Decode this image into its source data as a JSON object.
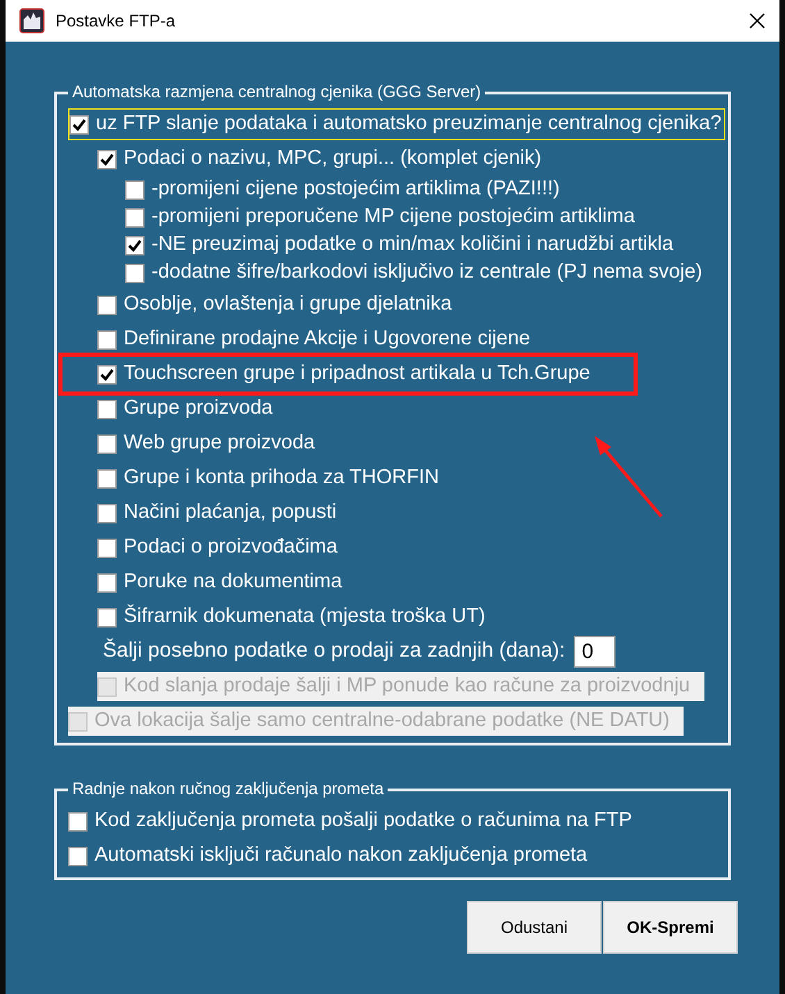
{
  "window": {
    "title": "Postavke FTP-a"
  },
  "group_1": {
    "legend": "Automatska razmjena centralnog cjenika (GGG Server)",
    "items": [
      {
        "kind": "checkbox",
        "label": "uz FTP slanje podataka i automatsko preuzimanje centralnog cjenika?",
        "checked": true,
        "disabled": false,
        "focused": true,
        "children": [
          {
            "kind": "checkbox",
            "label": "Podaci o nazivu, MPC, grupi... (komplet cjenik)",
            "checked": true,
            "disabled": false,
            "children": [
              {
                "kind": "checkbox",
                "label": "-promijeni cijene postojećim artiklima (PAZI!!!)",
                "checked": false,
                "disabled": false
              },
              {
                "kind": "checkbox",
                "label": "-promijeni preporučene MP cijene postojećim artiklima",
                "checked": false,
                "disabled": false
              },
              {
                "kind": "checkbox",
                "label": "-NE preuzimaj podatke o min/max količini i narudžbi artikla",
                "checked": true,
                "disabled": false
              },
              {
                "kind": "checkbox",
                "label": "-dodatne šifre/barkodovi isključivo iz centrale (PJ nema svoje)",
                "checked": false,
                "disabled": false
              }
            ]
          },
          {
            "kind": "checkbox",
            "label": "Osoblje, ovlaštenja i grupe djelatnika",
            "checked": false,
            "disabled": false
          },
          {
            "kind": "checkbox",
            "label": "Definirane prodajne Akcije i Ugovorene cijene",
            "checked": false,
            "disabled": false
          },
          {
            "kind": "checkbox",
            "label": "Touchscreen grupe i pripadnost artikala u Tch.Grupe",
            "checked": true,
            "disabled": false,
            "annotated": true
          },
          {
            "kind": "checkbox",
            "label": "Grupe proizvoda",
            "checked": false,
            "disabled": false
          },
          {
            "kind": "checkbox",
            "label": "Web grupe proizvoda",
            "checked": false,
            "disabled": false
          },
          {
            "kind": "checkbox",
            "label": "Grupe i konta prihoda za THORFIN",
            "checked": false,
            "disabled": false
          },
          {
            "kind": "checkbox",
            "label": "Načini plaćanja, popusti",
            "checked": false,
            "disabled": false
          },
          {
            "kind": "checkbox",
            "label": "Podaci o proizvođačima",
            "checked": false,
            "disabled": false
          },
          {
            "kind": "checkbox",
            "label": "Poruke na dokumentima",
            "checked": false,
            "disabled": false
          },
          {
            "kind": "checkbox",
            "label": "Šifrarnik dokumenata (mjesta troška UT)",
            "checked": false,
            "disabled": false
          },
          {
            "kind": "number",
            "label": "Šalji posebno podatke o prodaji za zadnjih (dana):",
            "value": "0"
          },
          {
            "kind": "checkbox",
            "label": "Kod slanja prodaje šalji i MP ponude kao račune za proizvodnju",
            "checked": false,
            "disabled": true
          }
        ]
      },
      {
        "kind": "checkbox",
        "label": "Ova lokacija šalje samo centralne-odabrane podatke (NE DATU)",
        "checked": false,
        "disabled": true
      }
    ]
  },
  "group_2": {
    "legend": "Radnje nakon ručnog zaključenja prometa",
    "items": [
      {
        "kind": "checkbox",
        "label": "Kod zaključenja prometa pošalji podatke o računima na FTP",
        "checked": false,
        "disabled": false
      },
      {
        "kind": "checkbox",
        "label": "Automatski isključi računalo nakon zaključenja prometa",
        "checked": false,
        "disabled": false
      }
    ]
  },
  "buttons": [
    {
      "label": "Odustani",
      "default": false
    },
    {
      "label": "OK-Spremi",
      "default": true
    }
  ]
}
